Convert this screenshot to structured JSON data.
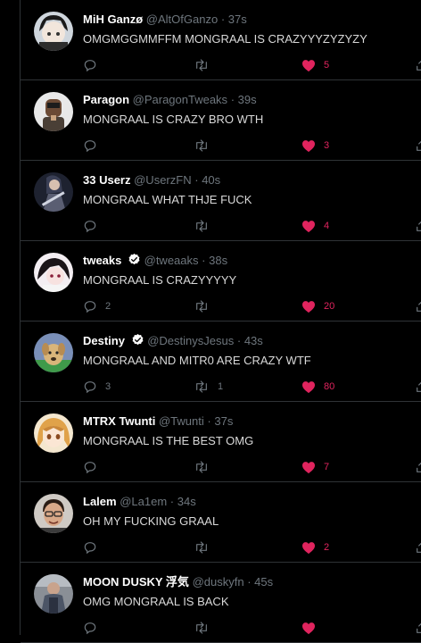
{
  "colors": {
    "background": "#000000",
    "divider": "#2f3336",
    "name": "#ffffff",
    "text": "#d9d9d9",
    "muted": "#6e767d",
    "like": "#e0245e"
  },
  "tweets": [
    {
      "name": "MiH Ganzø",
      "handle": "@AltOfGanzo",
      "dot": "·",
      "time": "37s",
      "text": "OMGMGGMMFFM MONGRAAL IS CRAZYYYZYZYZY",
      "verified": false,
      "reply_count": "",
      "retweet_count": "",
      "like_count": "5",
      "avatar_icon": "anime-avatar-icon"
    },
    {
      "name": "Paragon",
      "handle": "@ParagonTweaks",
      "dot": "·",
      "time": "39s",
      "text": "MONGRAAL IS CRAZY BRO WTH",
      "verified": false,
      "reply_count": "",
      "retweet_count": "",
      "like_count": "3",
      "avatar_icon": "character-avatar-icon"
    },
    {
      "name": "33 Userz",
      "handle": "@UserzFN",
      "dot": "·",
      "time": "40s",
      "text": "MONGRAAL WHAT THJE FUCK",
      "verified": false,
      "reply_count": "",
      "retweet_count": "",
      "like_count": "4",
      "avatar_icon": "guitar-player-avatar-icon"
    },
    {
      "name": "tweaks",
      "handle": "@tweaaks",
      "dot": "·",
      "time": "38s",
      "text": "MONGRAAL IS CRAZYYYYY",
      "verified": true,
      "reply_count": "2",
      "retweet_count": "",
      "like_count": "20",
      "avatar_icon": "anime-avatar-icon"
    },
    {
      "name": "Destiny",
      "handle": "@DestinysJesus",
      "dot": "·",
      "time": "43s",
      "text": "MONGRAAL AND MITR0 ARE CRAZY WTF",
      "verified": true,
      "reply_count": "3",
      "retweet_count": "1",
      "like_count": "80",
      "avatar_icon": "dog-avatar-icon"
    },
    {
      "name": "MTRX Twunti",
      "handle": "@Twunti",
      "dot": "·",
      "time": "37s",
      "text": "MONGRAAL IS THE BEST OMG",
      "verified": false,
      "reply_count": "",
      "retweet_count": "",
      "like_count": "7",
      "avatar_icon": "anime-girl-avatar-icon"
    },
    {
      "name": "Lalem",
      "handle": "@La1em",
      "dot": "·",
      "time": "34s",
      "text": "OH MY FUCKING GRAAL",
      "verified": false,
      "reply_count": "",
      "retweet_count": "",
      "like_count": "2",
      "avatar_icon": "person-avatar-icon"
    },
    {
      "name": "MOON DUSKY 浮気",
      "handle": "@duskyfn",
      "dot": "·",
      "time": "45s",
      "text": "OMG MONGRAAL IS BACK",
      "verified": false,
      "reply_count": "",
      "retweet_count": "",
      "like_count": "",
      "avatar_icon": "person-avatar-icon"
    }
  ]
}
